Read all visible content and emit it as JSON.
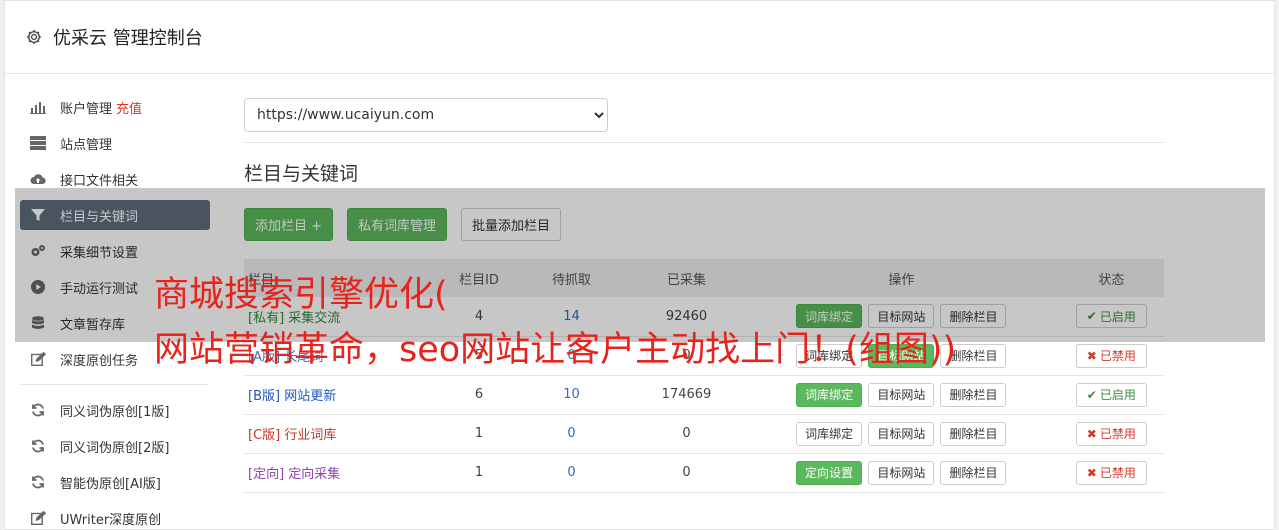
{
  "header": {
    "title": "优采云 管理控制台"
  },
  "sidebar": {
    "items": [
      {
        "label": "账户管理",
        "extra": "充值",
        "icon": "bar-chart-icon"
      },
      {
        "label": "站点管理",
        "icon": "server-icon"
      },
      {
        "label": "接口文件相关",
        "icon": "cloud-upload-icon"
      },
      {
        "label": "栏目与关键词",
        "icon": "filter-icon",
        "active": true
      },
      {
        "label": "采集细节设置",
        "icon": "cogs-icon"
      },
      {
        "label": "手动运行测试",
        "icon": "play-circle-icon"
      },
      {
        "label": "文章暂存库",
        "icon": "database-icon"
      },
      {
        "label": "深度原创任务",
        "icon": "edit-icon"
      }
    ],
    "items2": [
      {
        "label": "同义词伪原创[1版]",
        "icon": "refresh-icon"
      },
      {
        "label": "同义词伪原创[2版]",
        "icon": "refresh-icon"
      },
      {
        "label": "智能伪原创[AI版]",
        "icon": "refresh-icon"
      },
      {
        "label": "UWriter深度原创",
        "icon": "edit-icon"
      }
    ]
  },
  "main": {
    "site_select": "https://www.ucaiyun.com",
    "section_title": "栏目与关键词",
    "buttons": {
      "add_column": "添加栏目 +",
      "private_lib": "私有词库管理",
      "batch_add": "批量添加栏目"
    },
    "table": {
      "headers": {
        "name": "栏目",
        "id": "栏目ID",
        "pending": "待抓取",
        "done": "已采集",
        "ops": "操作",
        "status": "状态"
      },
      "rows": [
        {
          "tag": "[私有]",
          "name": "采集交流",
          "id": "4",
          "pending": "14",
          "done": "92460",
          "op1": "词库绑定",
          "op2": "目标网站",
          "op3": "删除栏目",
          "status": "已启用",
          "status_on": true
        },
        {
          "tag": "[A版]",
          "name": "长尾词",
          "id": "5",
          "pending": "0",
          "done": "0",
          "op1": "词库绑定",
          "op2": "目标网站",
          "op3": "删除栏目",
          "status": "已禁用",
          "status_on": false
        },
        {
          "tag": "[B版]",
          "name": "网站更新",
          "id": "6",
          "pending": "10",
          "done": "174669",
          "op1": "词库绑定",
          "op2": "目标网站",
          "op3": "删除栏目",
          "status": "已启用",
          "status_on": true
        },
        {
          "tag": "[C版]",
          "name": "行业词库",
          "id": "1",
          "pending": "0",
          "done": "0",
          "op1": "词库绑定",
          "op2": "目标网站",
          "op3": "删除栏目",
          "status": "已禁用",
          "status_on": false
        },
        {
          "tag": "[定向]",
          "name": "定向采集",
          "id": "1",
          "pending": "0",
          "done": "0",
          "op1": "定向设置",
          "op2": "目标网站",
          "op3": "删除栏目",
          "status": "已禁用",
          "status_on": false
        }
      ]
    }
  },
  "overlay": {
    "line1": "商城搜索引擎优化(",
    "line2": "网站营销革命，seo网站让客户主动找上门！(组图))"
  },
  "colors": {
    "accent_green": "#5cb85c",
    "active_nav": "#5f6b7a",
    "danger": "#d9372a",
    "ad_red": "#e8231c"
  }
}
